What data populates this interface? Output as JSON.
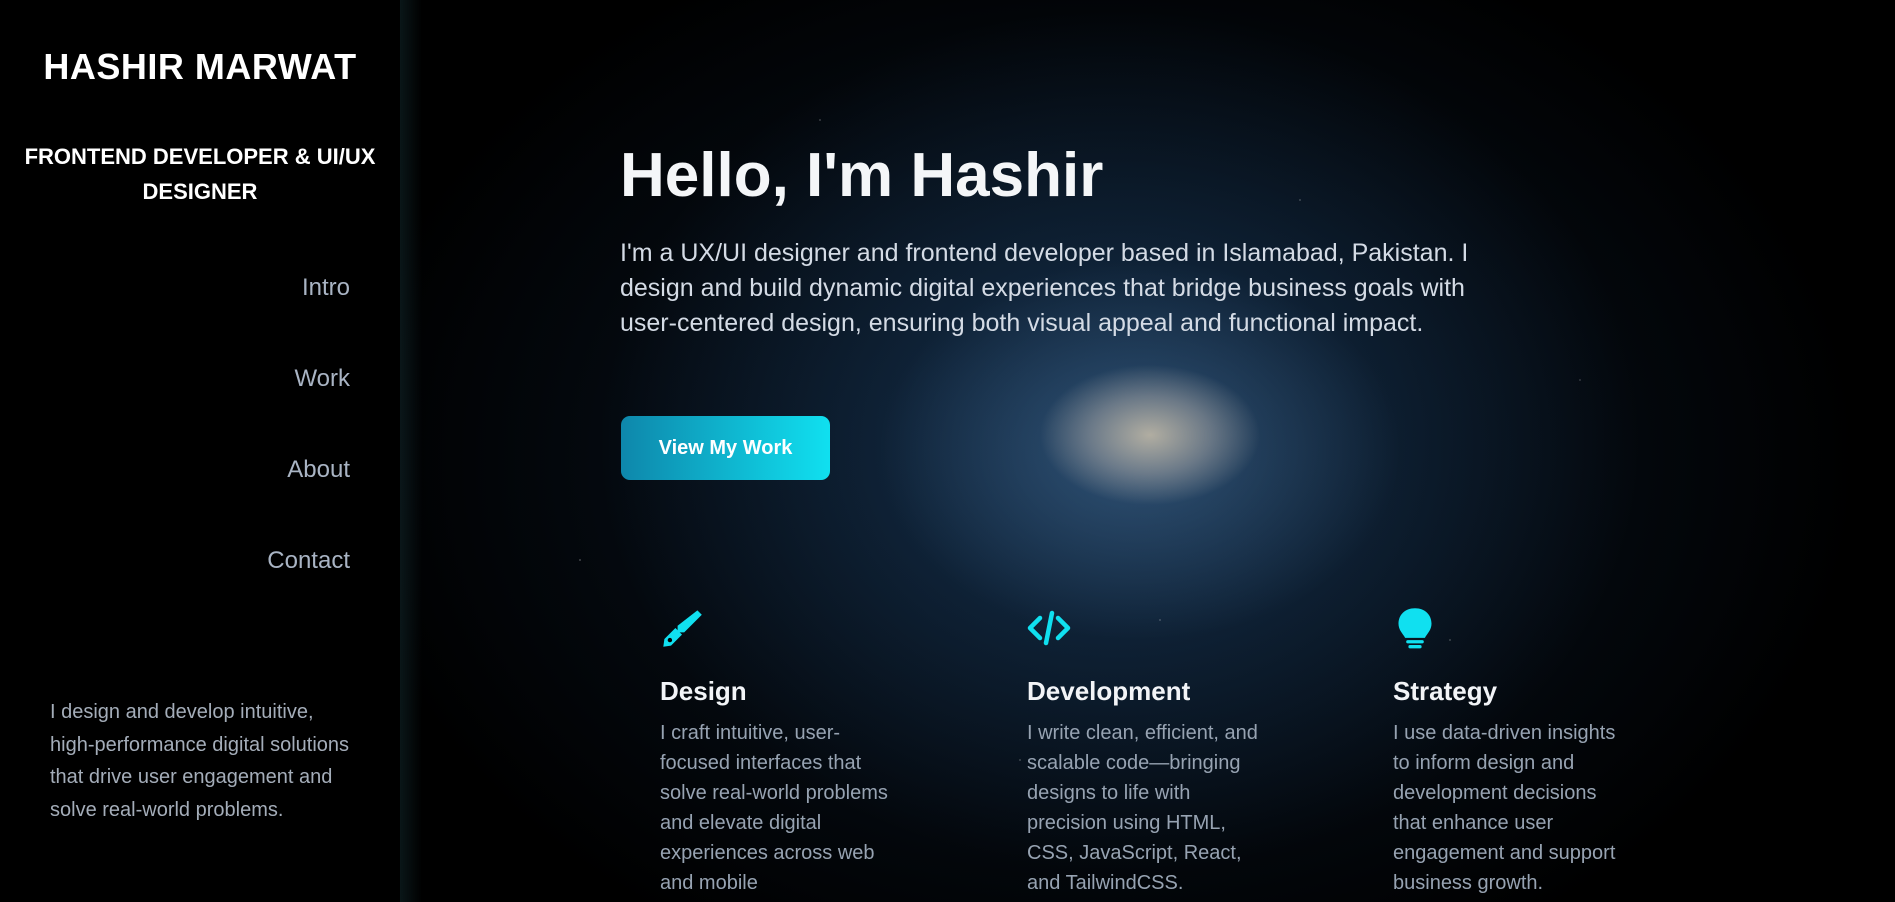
{
  "sidebar": {
    "name": "HASHIR MARWAT",
    "role": "FRONTEND DEVELOPER & UI/UX DESIGNER",
    "nav": [
      {
        "label": "Intro"
      },
      {
        "label": "Work"
      },
      {
        "label": "About"
      },
      {
        "label": "Contact"
      }
    ],
    "blurb": "I design and develop intuitive, high-performance digital solutions that drive user engagement and solve real-world problems."
  },
  "hero": {
    "title": "Hello, I'm Hashir",
    "text": "I'm a UX/UI designer and frontend developer based in Islamabad, Pakistan. I design and build dynamic digital experiences that bridge business goals with user-centered design, ensuring both visual appeal and functional impact.",
    "cta_label": "View My Work"
  },
  "services": [
    {
      "icon": "pen-nib-icon",
      "title": "Design",
      "description": "I craft intuitive, user-focused interfaces that solve real-world problems and elevate digital experiences across web and mobile"
    },
    {
      "icon": "code-icon",
      "title": "Development",
      "description": "I write clean, efficient, and scalable code—bringing designs to life with precision using HTML, CSS, JavaScript, React, and TailwindCSS."
    },
    {
      "icon": "lightbulb-icon",
      "title": "Strategy",
      "description": "I use data-driven insights to inform design and development decisions that enhance user engagement and support business growth."
    }
  ],
  "colors": {
    "accent": "#10e0f0",
    "accent_dark": "#0e87ab",
    "background": "#000000"
  }
}
